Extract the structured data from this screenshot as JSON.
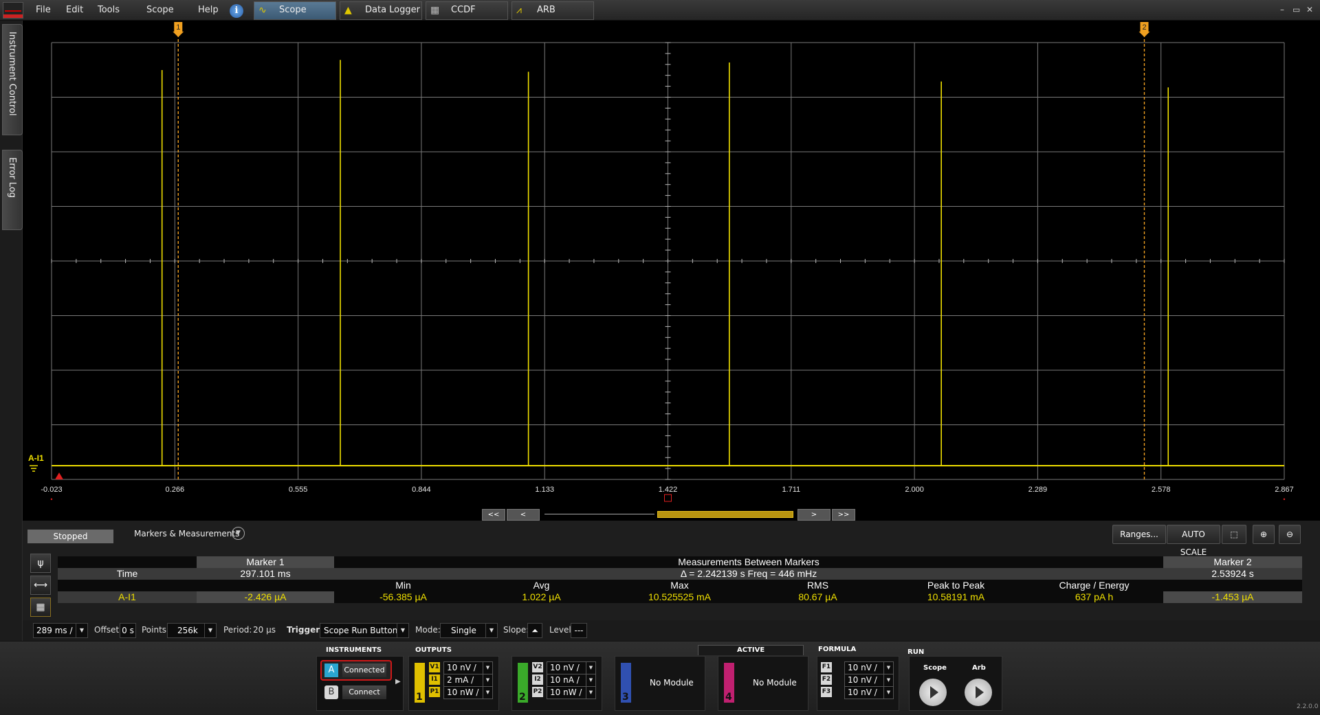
{
  "menu": [
    "File",
    "Edit",
    "Tools",
    "Scope",
    "Help"
  ],
  "tabs": [
    {
      "label": "Scope",
      "icon": "sine-wave-icon",
      "active": true
    },
    {
      "label": "Data Logger",
      "icon": "logger-icon",
      "active": false
    },
    {
      "label": "CCDF",
      "icon": "ccdf-icon",
      "active": false
    },
    {
      "label": "ARB",
      "icon": "arb-wave-icon",
      "active": false
    }
  ],
  "window_controls": [
    "–",
    "▭",
    "✕"
  ],
  "side_tabs": [
    "Instrument Control",
    "Error Log"
  ],
  "scope": {
    "x_ticks": [
      "-0.023",
      "0.266",
      "0.555",
      "0.844",
      "1.133",
      "1.422",
      "1.711",
      "2.000",
      "2.289",
      "2.578",
      "2.867"
    ],
    "channel_label": "A-I1",
    "trace_color": "#f0e000",
    "markers": [
      {
        "label": "1",
        "time": 0.274
      },
      {
        "label": "2",
        "time": 2.539
      }
    ],
    "spikes": [
      {
        "time": 0.236,
        "level": 0.935
      },
      {
        "time": 0.654,
        "level": 0.959
      },
      {
        "time": 1.095,
        "level": 0.931
      },
      {
        "time": 1.566,
        "level": 0.953
      },
      {
        "time": 2.063,
        "level": 0.908
      },
      {
        "time": 2.595,
        "level": 0.894
      }
    ]
  },
  "nav": {
    "first": "<<",
    "prev": "<",
    "next": ">",
    "last": ">>"
  },
  "status": "Stopped",
  "markers_measurements_label": "Markers & Measurements",
  "buttons": {
    "ranges": "Ranges...",
    "auto_scale": "AUTO SCALE"
  },
  "table": {
    "marker1_header": "Marker 1",
    "between_header": "Measurements Between Markers",
    "marker2_header": "Marker 2",
    "time_label": "Time",
    "marker1_time": "297.101 ms",
    "delta": "Δ = 2.242139 s   Freq = 446 mHz",
    "marker2_time": "2.53924 s",
    "columns": [
      "Min",
      "Avg",
      "Max",
      "RMS",
      "Peak to Peak",
      "Charge / Energy"
    ],
    "channel": "A-I1",
    "marker1_value": "-2.426 µA",
    "values": [
      "-56.385 µA",
      "1.022 µA",
      "10.525525 mA",
      "80.67 µA",
      "10.58191 mA",
      "637 pA h"
    ],
    "marker2_value": "-1.453 µA"
  },
  "settings": {
    "timebase": "289 ms /",
    "offset_label": "Offset:",
    "offset": "0 s",
    "points_label": "Points:",
    "points": "256k",
    "period_label": "Period:",
    "period": "20 µs",
    "trigger_label": "Trigger",
    "trigger_source": "Scope Run Button",
    "mode_label": "Mode:",
    "mode": "Single",
    "slope_label": "Slope:",
    "level_label": "Level:",
    "level": "---"
  },
  "bottom": {
    "instruments_label": "INSTRUMENTS",
    "outputs_label": "OUTPUTS",
    "active_label": "ACTIVE",
    "formula_label": "FORMULA",
    "run_label": "RUN",
    "instrument_a": {
      "letter": "A",
      "status": "Connected"
    },
    "instrument_b": {
      "letter": "B",
      "status": "Connect"
    },
    "ch1": {
      "num": "1",
      "color": "#e0c000",
      "rows": [
        {
          "chip": "V1",
          "value": "10 nV /"
        },
        {
          "chip": "I1",
          "value": "2 mA /"
        },
        {
          "chip": "P1",
          "value": "10 nW /"
        }
      ]
    },
    "ch2": {
      "num": "2",
      "color": "#3aaa2a",
      "rows": [
        {
          "chip": "V2",
          "value": "10 nV /"
        },
        {
          "chip": "I2",
          "value": "10 nA /"
        },
        {
          "chip": "P2",
          "value": "10 nW /"
        }
      ]
    },
    "ch3": {
      "num": "3",
      "color": "#3050b0",
      "text": "No Module"
    },
    "ch4": {
      "num": "4",
      "color": "#c02070",
      "text": "No Module"
    },
    "formula": [
      {
        "chip": "F1",
        "value": "10 nV /"
      },
      {
        "chip": "F2",
        "value": "10 nV /"
      },
      {
        "chip": "F3",
        "value": "10 nV /"
      }
    ],
    "run_scope": "Scope",
    "run_arb": "Arb",
    "version": "2.2.0.0"
  }
}
